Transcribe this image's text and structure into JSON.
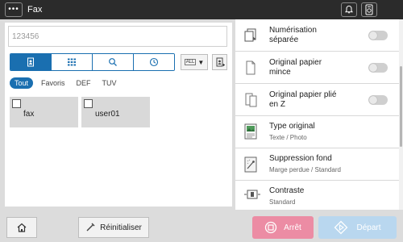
{
  "header": {
    "title": "Fax",
    "menu_glyph": "•••",
    "icons": [
      "bell-icon",
      "device-status-icon"
    ]
  },
  "left": {
    "dest_value": "123456",
    "segments": [
      {
        "icon": "address-book-icon",
        "active": true
      },
      {
        "icon": "keypad-icon",
        "active": false
      },
      {
        "icon": "search-icon",
        "active": false
      },
      {
        "icon": "history-icon",
        "active": false
      }
    ],
    "all_label": "ALL",
    "filters": [
      "Tout",
      "Favoris",
      "DEF",
      "TUV"
    ],
    "active_filter": "Tout",
    "entries": [
      {
        "label": "fax"
      },
      {
        "label": "user01"
      }
    ]
  },
  "right": {
    "rows": [
      {
        "name": "separate-scan",
        "line1": "Numérisation",
        "line2": "séparée",
        "toggle": false
      },
      {
        "name": "thin-paper",
        "line1": "Original papier",
        "line2": "mince",
        "toggle": false
      },
      {
        "name": "z-folded",
        "line1": "Original papier plié",
        "line2": "en Z",
        "toggle": false
      },
      {
        "name": "original-type",
        "line1": "Type original",
        "sub": "Texte / Photo"
      },
      {
        "name": "bg-removal",
        "line1": "Suppression fond",
        "sub": "Marge perdue / Standard"
      },
      {
        "name": "contrast",
        "line1": "Contraste",
        "sub": "Standard"
      }
    ]
  },
  "footer": {
    "reset": "Réinitialiser",
    "stop": "Arrêt",
    "start": "Départ"
  },
  "colors": {
    "accent": "#1a6fb0",
    "stop": "#ec8ca4",
    "start": "#b9d7ef",
    "topbar": "#2b2b2b"
  }
}
